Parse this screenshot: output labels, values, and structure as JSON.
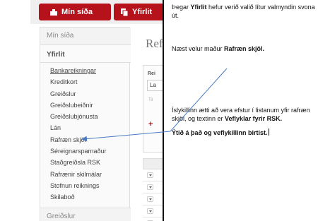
{
  "topbar": {
    "primary_button": "Mín síða",
    "secondary_button": "Yfirlit"
  },
  "sidebar": {
    "header1": "Mín síða",
    "header2": "Yfirlit",
    "items": [
      "Bankareikningar",
      "Kreditkort",
      "Greiðslur",
      "Greiðslubeiðnir",
      "Greiðslubjónusta",
      "Lán",
      "Rafræn skjöl",
      "Séreignarsparnaður",
      "Staðgreiðsla RSK",
      "Rafrænir skilmálar",
      "Stofnun reiknings",
      "Skilaboð"
    ],
    "footer": "Greiðslur"
  },
  "main": {
    "title": "Ref",
    "panel_label": "Rei",
    "panel_input": "La",
    "panel_small": "Til",
    "panel_plus": "+"
  },
  "text": {
    "p1_a": "Þegar ",
    "p1_b": "Yfirlit",
    "p1_c": " hefur verið valið lítur valmyndin svona út.",
    "p2_a": "Næst velur maður ",
    "p2_b": "Rafræn skjöl.",
    "p3_a": "Ísl​ykillinn ætti að vera efstur í listanum yfir rafræn skjöl, og textinn er ",
    "p3_b": "Veflyklar fyrir RSK.",
    "p4": "Ýtið á það og veflykillinn birtist."
  },
  "colors": {
    "brand_red": "#b5121b",
    "arrow": "#4a7bc4"
  }
}
